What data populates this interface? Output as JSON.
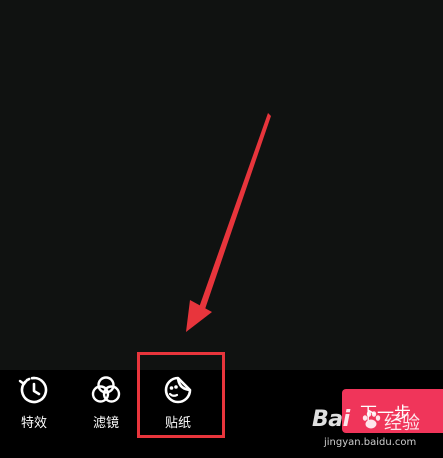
{
  "toolbar": {
    "items": [
      {
        "label": "特效",
        "icon": "effects-timer-icon"
      },
      {
        "label": "滤镜",
        "icon": "filter-circles-icon"
      },
      {
        "label": "贴纸",
        "icon": "sticker-face-icon"
      }
    ],
    "next_label": "下一步"
  },
  "annotation": {
    "color": "#e8353c",
    "target": "贴纸"
  },
  "watermark": {
    "brand": "Bai",
    "brand_cn": "经验",
    "url": "jingyan.baidu.com"
  },
  "colors": {
    "background": "#000000",
    "preview": "#101211",
    "next_button": "#f0355a",
    "annotation": "#e8353c"
  }
}
